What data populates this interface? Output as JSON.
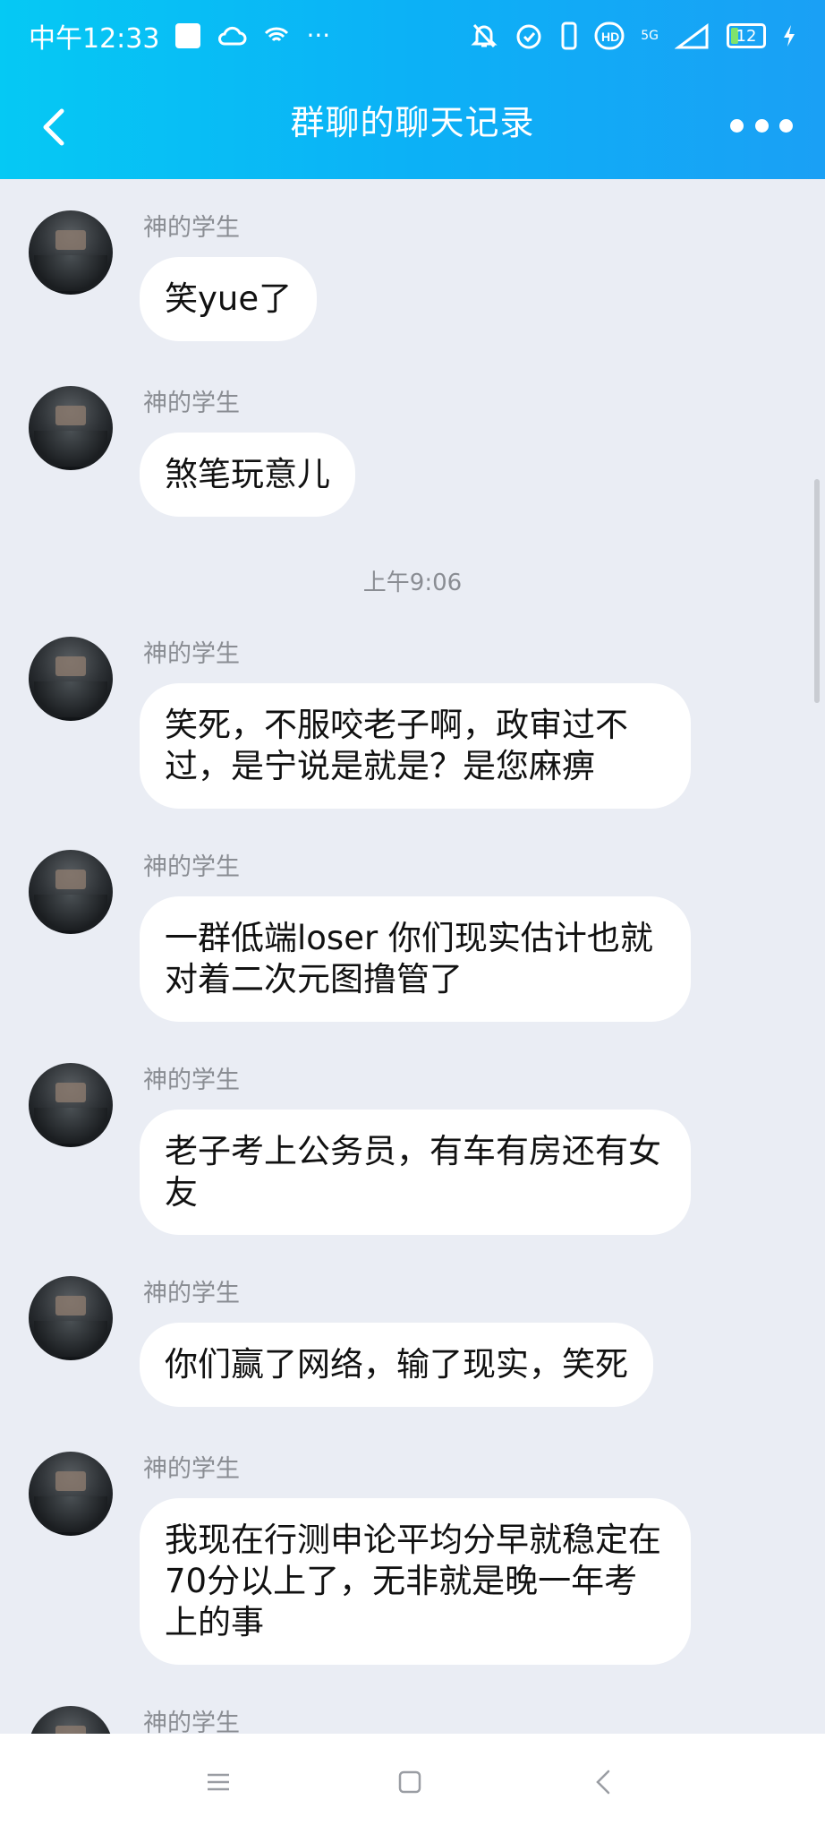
{
  "status": {
    "time": "中午12:33",
    "more": "···",
    "network": "5G",
    "battery": "12"
  },
  "header": {
    "title": "群聊的聊天记录"
  },
  "messages": [
    {
      "sender": "神的学生",
      "text": "笑yue了"
    },
    {
      "sender": "神的学生",
      "text": "煞笔玩意儿"
    },
    {
      "sender": "神的学生",
      "text": "笑死，不服咬老子啊，政审过不过，是宁说是就是？是您麻痹"
    },
    {
      "sender": "神的学生",
      "text": "一群低端loser 你们现实估计也就对着二次元图撸管了"
    },
    {
      "sender": "神的学生",
      "text": "老子考上公务员，有车有房还有女友"
    },
    {
      "sender": "神的学生",
      "text": "你们赢了网络，输了现实，笑死"
    },
    {
      "sender": "神的学生",
      "text": "我现在行测申论平均分早就稳定在70分以上了，无非就是晚一年考上的事"
    },
    {
      "sender": "神的学生",
      "text": ""
    }
  ],
  "timestamp": "上午9:06"
}
